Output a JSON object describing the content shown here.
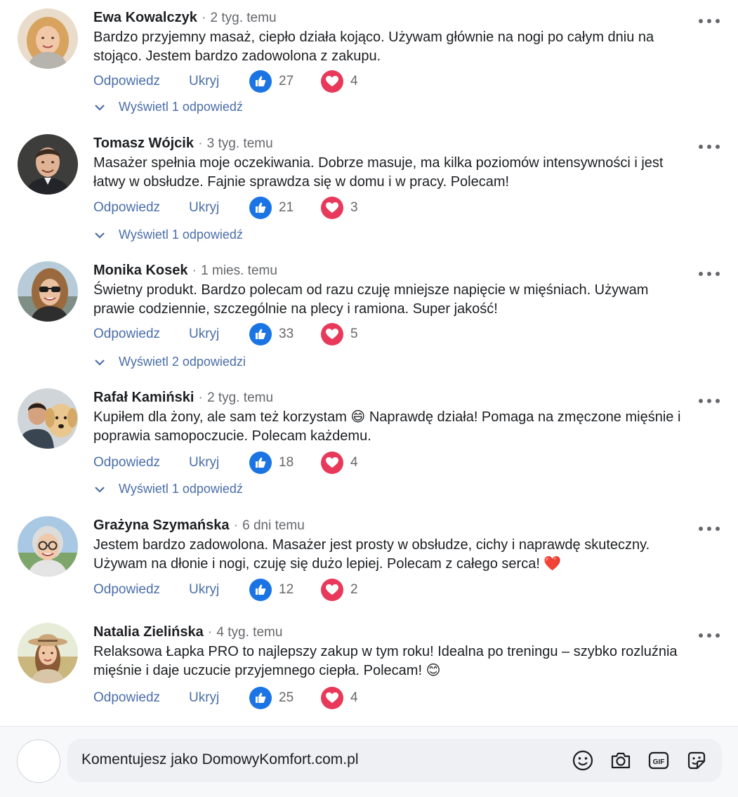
{
  "comments": [
    {
      "author": "Ewa Kowalczyk",
      "time": "2 tyg. temu",
      "text": "Bardzo przyjemny masaż, ciepło działa kojąco. Używam głównie na nogi po całym dniu na stojąco. Jestem bardzo zadowolona z zakupu.",
      "reply_label": "Odpowiedz",
      "hide_label": "Ukryj",
      "likes": "27",
      "loves": "4",
      "replies_label": "Wyświetl 1 odpowiedź"
    },
    {
      "author": "Tomasz Wójcik",
      "time": "3 tyg. temu",
      "text": "Masażer spełnia moje oczekiwania. Dobrze masuje, ma kilka poziomów intensywności i jest łatwy w obsłudze. Fajnie sprawdza się w domu i w pracy. Polecam!",
      "reply_label": "Odpowiedz",
      "hide_label": "Ukryj",
      "likes": "21",
      "loves": "3",
      "replies_label": "Wyświetl 1 odpowiedź"
    },
    {
      "author": "Monika Kosek",
      "time": "1 mies. temu",
      "text": "Świetny produkt. Bardzo polecam od razu czuję mniejsze napięcie w mięśniach. Używam prawie codziennie, szczególnie na plecy i ramiona. Super jakość!",
      "reply_label": "Odpowiedz",
      "hide_label": "Ukryj",
      "likes": "33",
      "loves": "5",
      "replies_label": "Wyświetl 2 odpowiedzi"
    },
    {
      "author": "Rafał Kamiński",
      "time": "2 tyg. temu",
      "text": "Kupiłem dla żony, ale sam też korzystam 😄 Naprawdę działa! Pomaga na zmęczone mięśnie i poprawia samopoczucie. Polecam każdemu.",
      "reply_label": "Odpowiedz",
      "hide_label": "Ukryj",
      "likes": "18",
      "loves": "4",
      "replies_label": "Wyświetl 1 odpowiedź"
    },
    {
      "author": "Grażyna Szymańska",
      "time": "6 dni temu",
      "text": "Jestem bardzo zadowolona. Masażer jest prosty w obsłudze, cichy i naprawdę skuteczny. Używam na dłonie i nogi, czuję się dużo lepiej. Polecam z całego serca! ❤️",
      "reply_label": "Odpowiedz",
      "hide_label": "Ukryj",
      "likes": "12",
      "loves": "2",
      "replies_label": ""
    },
    {
      "author": "Natalia Zielińska",
      "time": "4 tyg. temu",
      "text": "Relaksowa Łapka PRO to najlepszy zakup w tym roku! Idealna po treningu – szybko rozluźnia mięśnie i daje uczucie przyjemnego ciepła. Polecam! 😊",
      "reply_label": "Odpowiedz",
      "hide_label": "Ukryj",
      "likes": "25",
      "loves": "4",
      "replies_label": ""
    }
  ],
  "composer": {
    "placeholder": "Komentujesz jako DomowyKomfort.com.pl",
    "tools": [
      "emoji-icon",
      "camera-icon",
      "gif-icon",
      "sticker-icon"
    ]
  },
  "icons": {
    "like": "thumbs-up-icon",
    "love": "heart-icon",
    "more": "more-dots-icon",
    "expand": "chevron-down-icon"
  },
  "colors": {
    "like": "#1b74e4",
    "love": "#e8395b",
    "link": "#4b6ea9",
    "muted": "#65676b"
  }
}
